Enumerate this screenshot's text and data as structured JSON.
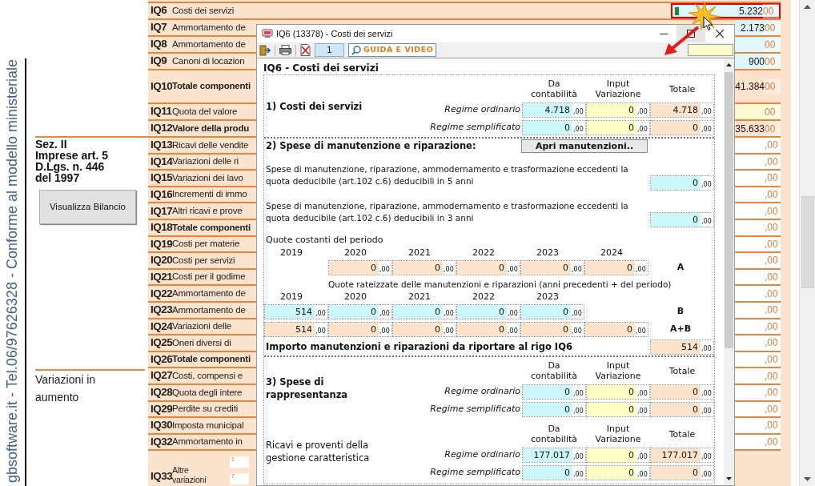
{
  "side_caption": "gbsoftware.it - Tel.06/97626328 - Conforme al modello ministeriale",
  "section_heading": [
    "Sez. II",
    "Imprese art. 5",
    "D.Lgs. n. 446",
    "del 1997"
  ],
  "view_button": "Visualizza Bilancio",
  "variations_label": "Variazioni in aumento",
  "rows": [
    {
      "code": "IQ6",
      "label": "Costi dei servizi",
      "bold": false,
      "tall": false,
      "value": "5.232",
      "decimals": "00",
      "kind": "input",
      "highlighted": true
    },
    {
      "code": "IQ7",
      "label": "Ammortamento de",
      "bold": false,
      "tall": false,
      "value": "2.173",
      "decimals": "00",
      "kind": "input",
      "highlighted": false
    },
    {
      "code": "IQ8",
      "label": "Ammortamento de",
      "bold": false,
      "tall": false,
      "decimals": "00",
      "kind": "input",
      "highlighted": false
    },
    {
      "code": "IQ9",
      "label": "Canoni di locazion",
      "bold": false,
      "tall": false,
      "value": "900",
      "decimals": "00",
      "kind": "input",
      "highlighted": false
    },
    {
      "code": "IQ10",
      "label": "Totale componenti",
      "bold": true,
      "tall": true,
      "value": "41.384",
      "decimals": "00",
      "kind": "total",
      "highlighted": false
    },
    {
      "code": "IQ11",
      "label": "Quota del valore",
      "bold": false,
      "tall": false,
      "decimals": "00",
      "kind": "variation",
      "highlighted": false
    },
    {
      "code": "IQ12",
      "label": "Valore della produ",
      "bold": true,
      "tall": false,
      "value": "35.633",
      "decimals": "00",
      "kind": "total",
      "highlighted": false
    },
    {
      "code": "IQ13",
      "label": "Ricavi delle vendite",
      "bold": false,
      "tall": false,
      "decimals": ",00",
      "kind": "plain",
      "highlighted": false
    },
    {
      "code": "IQ14",
      "label": "Variazioni delle ri",
      "bold": false,
      "tall": false,
      "decimals": ",00",
      "kind": "plain",
      "highlighted": false
    },
    {
      "code": "IQ15",
      "label": "Variazioni dei lavo",
      "bold": false,
      "tall": false,
      "decimals": ",00",
      "kind": "plain",
      "highlighted": false
    },
    {
      "code": "IQ16",
      "label": "Incrementi di immo",
      "bold": false,
      "tall": false,
      "decimals": ",00",
      "kind": "plain",
      "highlighted": false
    },
    {
      "code": "IQ17",
      "label": "Altri ricavi e prove",
      "bold": false,
      "tall": false,
      "decimals": ",00",
      "kind": "plain",
      "highlighted": false
    },
    {
      "code": "IQ18",
      "label": "Totale componenti",
      "bold": true,
      "tall": false,
      "decimals": ",00",
      "kind": "plain",
      "highlighted": false
    },
    {
      "code": "IQ19",
      "label": "Costi per materie",
      "bold": false,
      "tall": false,
      "decimals": ",00",
      "kind": "plain",
      "highlighted": false
    },
    {
      "code": "IQ20",
      "label": "Costi per servizi",
      "bold": false,
      "tall": false,
      "decimals": ",00",
      "kind": "plain",
      "highlighted": false
    },
    {
      "code": "IQ21",
      "label": "Costi per il godime",
      "bold": false,
      "tall": false,
      "decimals": ",00",
      "kind": "plain",
      "highlighted": false
    },
    {
      "code": "IQ22",
      "label": "Ammortamento de",
      "bold": false,
      "tall": false,
      "decimals": ",00",
      "kind": "plain",
      "highlighted": false
    },
    {
      "code": "IQ23",
      "label": "Ammortamento de",
      "bold": false,
      "tall": false,
      "decimals": ",00",
      "kind": "plain",
      "highlighted": false
    },
    {
      "code": "IQ24",
      "label": "Variazioni delle",
      "bold": false,
      "tall": false,
      "decimals": ",00",
      "kind": "plain",
      "highlighted": false
    },
    {
      "code": "IQ25",
      "label": "Oneri diversi di",
      "bold": false,
      "tall": false,
      "decimals": ",00",
      "kind": "plain",
      "highlighted": false
    },
    {
      "code": "IQ26",
      "label": "Totale componenti",
      "bold": true,
      "tall": false,
      "decimals": ",00",
      "kind": "plain",
      "highlighted": false
    },
    {
      "code": "IQ27",
      "label": "Costi, compensi e",
      "bold": false,
      "tall": false,
      "decimals": ",00",
      "kind": "plain",
      "highlighted": false
    },
    {
      "code": "IQ28",
      "label": "Quota degli intere",
      "bold": false,
      "tall": false,
      "decimals": ",00",
      "kind": "plain",
      "highlighted": false
    },
    {
      "code": "IQ29",
      "label": "Perdite su crediti",
      "bold": false,
      "tall": false,
      "decimals": ",00",
      "kind": "plain",
      "highlighted": false
    },
    {
      "code": "IQ30",
      "label": "Imposta municipal",
      "bold": false,
      "tall": false,
      "decimals": ",00",
      "kind": "plain",
      "highlighted": false
    },
    {
      "code": "IQ32",
      "label": "Ammortamento in",
      "bold": false,
      "tall": false,
      "decimals": ",00",
      "kind": "plain",
      "highlighted": false
    },
    {
      "code": "IQ33",
      "label": "Altre variazioni",
      "bold": false,
      "tall": true,
      "boxes": [
        "1",
        "7"
      ]
    }
  ],
  "dialog": {
    "title": "IQ6 (13378) - Costi dei servizi",
    "page": "1",
    "help_button": "GUIDA E VIDEO",
    "heading": "IQ6 - Costi dei servizi",
    "blocks": [
      {
        "kind": "regime",
        "separated": true,
        "title": "1) Costi dei servizi",
        "title_bold": true,
        "headers": [
          "Da contabilità",
          "Input Variazione",
          "Totale"
        ],
        "rows": [
          {
            "label": "Regime ordinario",
            "cells": [
              {
                "kind": "input",
                "value": "4.718",
                "decimals": ",00"
              },
              {
                "kind": "variation",
                "value": "0",
                "decimals": ",00"
              },
              {
                "kind": "total",
                "value": "4.718",
                "decimals": ",00"
              }
            ]
          },
          {
            "label": "Regime semplificato",
            "cells": [
              {
                "kind": "input",
                "value": "0",
                "decimals": ",00"
              },
              {
                "kind": "variation",
                "value": "0",
                "decimals": ",00"
              },
              {
                "kind": "total",
                "value": "0",
                "decimals": ",00"
              }
            ]
          }
        ]
      },
      {
        "kind": "heading_button",
        "separated": false,
        "title": "2) Spese di manutenzione e riparazione:",
        "button": "Apri manutenzioni.."
      },
      {
        "kind": "paragraph_field",
        "separated": false,
        "text": "Spese di manutenzione, riparazione, ammodernamento e trasformazione eccedenti la quota deducibile (art.102 c.6) deducibili in 5 anni",
        "field": {
          "kind": "input",
          "value": "0",
          "decimals": ",00"
        }
      },
      {
        "kind": "paragraph_field",
        "separated": false,
        "text": "Spese di manutenzione, riparazione, ammodernamento e trasformazione eccedenti la quota deducibile (art.102 c.6) deducibili in 3 anni",
        "field": {
          "kind": "input",
          "value": "0",
          "decimals": ",00"
        }
      },
      {
        "kind": "label",
        "separated": false,
        "text": "Quote costanti del periodo"
      },
      {
        "kind": "years",
        "separated": false,
        "years": [
          "2019",
          "2020",
          "2021",
          "2022",
          "2023",
          "2024"
        ]
      },
      {
        "kind": "grid_row",
        "separated": false,
        "tag": "A",
        "cells": [
          {
            "kind": "blank"
          },
          {
            "kind": "total",
            "value": "0",
            "decimals": ",00"
          },
          {
            "kind": "total",
            "value": "0",
            "decimals": ",00"
          },
          {
            "kind": "total",
            "value": "0",
            "decimals": ",00"
          },
          {
            "kind": "total",
            "value": "0",
            "decimals": ",00"
          },
          {
            "kind": "total",
            "value": "0",
            "decimals": ",00"
          }
        ]
      },
      {
        "kind": "caption",
        "separated": false,
        "text": "Quote rateizzate delle manutenzioni e riparazioni (anni precedenti + del periodo)"
      },
      {
        "kind": "years",
        "separated": false,
        "years": [
          "2019",
          "2020",
          "2021",
          "2022",
          "2023"
        ]
      },
      {
        "kind": "grid_row",
        "separated": false,
        "tag": "B",
        "cells": [
          {
            "kind": "input",
            "value": "514",
            "decimals": ",00"
          },
          {
            "kind": "input",
            "value": "0",
            "decimals": ",00"
          },
          {
            "kind": "input",
            "value": "0",
            "decimals": ",00"
          },
          {
            "kind": "input",
            "value": "0",
            "decimals": ",00"
          },
          {
            "kind": "input",
            "value": "0",
            "decimals": ",00"
          }
        ]
      },
      {
        "kind": "grid_row",
        "separated": false,
        "tag": "A+B",
        "cells": [
          {
            "kind": "total",
            "value": "514",
            "decimals": ",00"
          },
          {
            "kind": "total",
            "value": "0",
            "decimals": ",00"
          },
          {
            "kind": "total",
            "value": "0",
            "decimals": ",00"
          },
          {
            "kind": "total",
            "value": "0",
            "decimals": ",00"
          },
          {
            "kind": "total",
            "value": "0",
            "decimals": ",00"
          },
          {
            "kind": "total",
            "value": "0",
            "decimals": ",00"
          }
        ]
      },
      {
        "kind": "total_line",
        "separated": true,
        "text": "Importo manutenzioni e riparazioni da riportare al rigo IQ6",
        "field": {
          "kind": "total",
          "value": "514",
          "decimals": ",00"
        }
      },
      {
        "kind": "regime",
        "separated": false,
        "title": "3) Spese di rappresentanza",
        "title_bold": true,
        "headers": [
          "Da contabilità",
          "Input Variazione",
          "Totale"
        ],
        "rows": [
          {
            "label": "Regime ordinario",
            "cells": [
              {
                "kind": "input",
                "value": "0",
                "decimals": ",00"
              },
              {
                "kind": "variation",
                "value": "0",
                "decimals": ",00"
              },
              {
                "kind": "total",
                "value": "0",
                "decimals": ",00"
              }
            ]
          },
          {
            "label": "Regime semplificato",
            "cells": [
              {
                "kind": "input",
                "value": "0",
                "decimals": ",00"
              },
              {
                "kind": "variation",
                "value": "0",
                "decimals": ",00"
              },
              {
                "kind": "total",
                "value": "0",
                "decimals": ",00"
              }
            ]
          }
        ]
      },
      {
        "kind": "regime",
        "separated": false,
        "title": "Ricavi e proventi della gestione caratteristica",
        "title_bold": false,
        "headers": [
          "Da contabilità",
          "Input Variazione",
          "Totale"
        ],
        "rows": [
          {
            "label": "Regime ordinario",
            "cells": [
              {
                "kind": "input",
                "value": "177.017",
                "decimals": ",00"
              },
              {
                "kind": "variation",
                "value": "0",
                "decimals": ",00"
              },
              {
                "kind": "total",
                "value": "177.017",
                "decimals": ",00"
              }
            ]
          },
          {
            "label": "Regime semplificato",
            "cells": [
              {
                "kind": "input",
                "value": "0",
                "decimals": ",00"
              },
              {
                "kind": "variation",
                "value": "0",
                "decimals": ",00"
              },
              {
                "kind": "total",
                "value": "0",
                "decimals": ",00"
              }
            ]
          }
        ]
      }
    ]
  }
}
